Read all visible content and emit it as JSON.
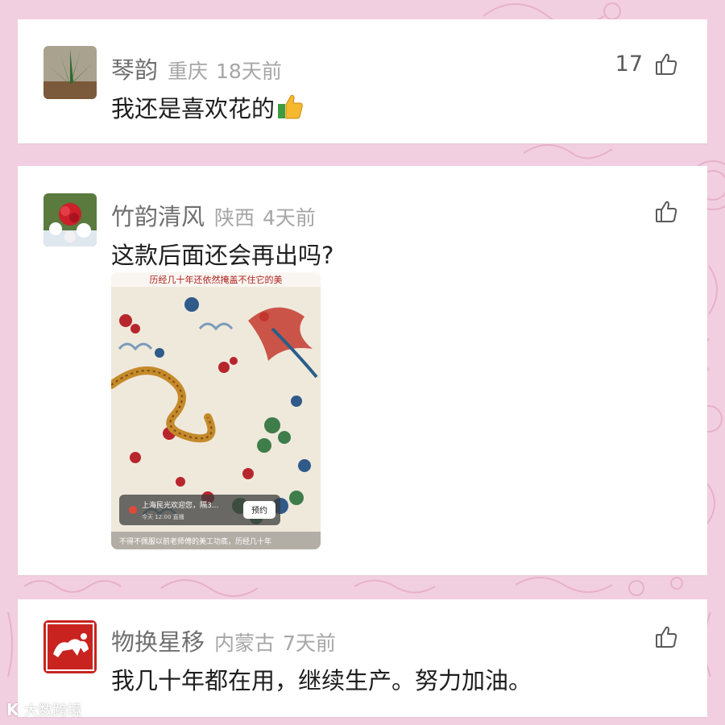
{
  "comments": [
    {
      "username": "琴韵",
      "location": "重庆",
      "time": "18天前",
      "text": "我还是喜欢花的",
      "emoji": "thumbs-up-emoji",
      "likes": "17"
    },
    {
      "username": "竹韵清风",
      "location": "陕西",
      "time": "4天前",
      "text": "这款后面还会再出吗?",
      "likes": "",
      "attachment": {
        "banner": "历经几十年还依然掩盖不住它的美",
        "promo_title": "上海民光欢迎您，隔3...",
        "promo_sub": "今天 12:00 直播",
        "promo_button": "预约",
        "caption": "不得不佩服以前老师傅的美工功底，历经几十年"
      }
    },
    {
      "username": "物换星移",
      "location": "内蒙古",
      "time": "7天前",
      "text": "我几十年都在用，继续生产。努力加油。",
      "likes": ""
    }
  ],
  "watermark": {
    "logo": "K",
    "text": "大数跨境"
  },
  "colors": {
    "background": "#f2cfe0",
    "card": "#ffffff",
    "username": "#6f6f6f",
    "meta": "#a6a6a6",
    "text": "#1e1e1e"
  }
}
